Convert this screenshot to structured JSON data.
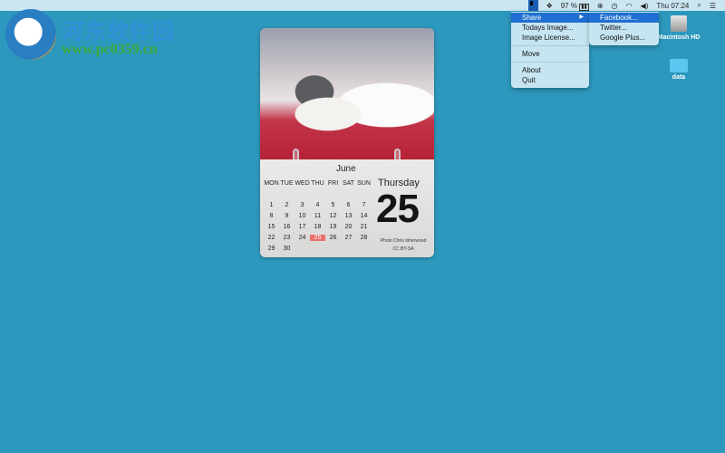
{
  "menubar": {
    "battery": "97 %",
    "clock": "Thu 07:24"
  },
  "menu": {
    "items": [
      "Share",
      "Todays Image...",
      "Image License...",
      "Move",
      "About",
      "Quit"
    ]
  },
  "submenu": {
    "items": [
      "Facebook...",
      "Twitter...",
      "Google Plus..."
    ]
  },
  "desktop": {
    "icons": [
      "Macintosh HD",
      "data"
    ]
  },
  "watermark": {
    "title": "河东软件园",
    "url": "www.pc0359.cn"
  },
  "calendar": {
    "month": "June",
    "weekdays": [
      "MON",
      "TUE",
      "WED",
      "THU",
      "FRI",
      "SAT",
      "SUN"
    ],
    "weeks": [
      [
        "1",
        "2",
        "3",
        "4",
        "5",
        "6",
        "7"
      ],
      [
        "8",
        "9",
        "10",
        "11",
        "12",
        "13",
        "14"
      ],
      [
        "15",
        "16",
        "17",
        "18",
        "19",
        "20",
        "21"
      ],
      [
        "22",
        "23",
        "24",
        "25",
        "26",
        "27",
        "28"
      ],
      [
        "29",
        "30",
        "",
        "",
        "",
        "",
        ""
      ]
    ],
    "today": "25",
    "weekday_name": "Thursday",
    "day_number": "25",
    "credit_line1": "Photo Chris Isherwood",
    "credit_line2": "CC BY-SA"
  },
  "colors": {
    "desktop": "#2d98bd",
    "highlight": "#1f6fd0",
    "today": "#e8706c"
  }
}
